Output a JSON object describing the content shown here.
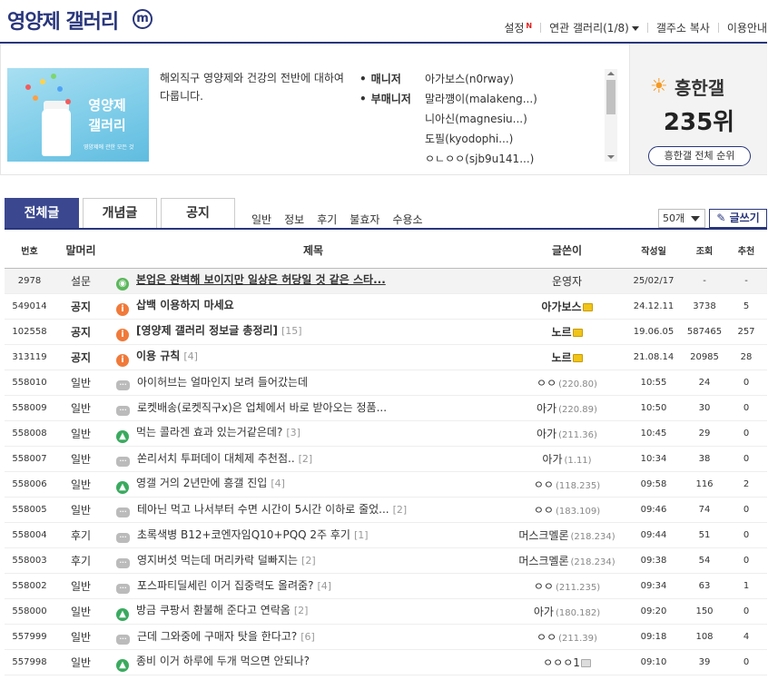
{
  "header": {
    "title": "영양제 갤러리",
    "badge": "m",
    "menu": [
      {
        "label": "설정",
        "new": "N"
      },
      {
        "label": "연관 갤러리(1/8)",
        "caret": true
      },
      {
        "label": "갤주소 복사"
      },
      {
        "label": "이용안내"
      }
    ]
  },
  "info": {
    "thumbnail_text": "영양제\n갤러리",
    "thumbnail_small": "영양제에 관한 모든 것",
    "description": "해외직구 영양제와 건강의 전반에 대하여 다룹니다.",
    "manager_label": "매니저",
    "manager": "아가보스(n0rway)",
    "sub_manager_label": "부매니저",
    "sub_managers": [
      "말라꺵이(malakeng...)",
      "니아신(magnesiu...)",
      "도필(kyodophi...)",
      "ㅇㄴㅇㅇ(sjb9u141...)"
    ],
    "rank_label": "흥한갤",
    "rank_value": "235위",
    "rank_button": "흥한갤 전체 순위"
  },
  "tabs": {
    "main": [
      {
        "label": "전체글",
        "active": true
      },
      {
        "label": "개념글",
        "active": false
      },
      {
        "label": "공지",
        "active": false
      }
    ],
    "sub": [
      "일반",
      "정보",
      "후기",
      "불효자",
      "수용소"
    ],
    "page_size": "50개",
    "write_button": "글쓰기"
  },
  "table": {
    "headers": [
      "번호",
      "말머리",
      "제목",
      "글쓴이",
      "작성일",
      "조회",
      "추천"
    ],
    "rows": [
      {
        "no": "2978",
        "head": "설문",
        "icon": "survey",
        "subject": "본업은 완벽해 보이지만 일상은 허당일 것 같은 스타...",
        "replies": "",
        "writer": "운영자",
        "ip": "",
        "badge": "",
        "date": "25/02/17",
        "views": "-",
        "recs": "-",
        "type": "pinned"
      },
      {
        "no": "549014",
        "head": "공지",
        "icon": "notice",
        "subject": "삽백 이용하지 마세요",
        "replies": "",
        "writer": "아가보스",
        "ip": "",
        "badge": "gold",
        "date": "24.12.11",
        "views": "3738",
        "recs": "5",
        "type": "notice"
      },
      {
        "no": "102558",
        "head": "공지",
        "icon": "notice",
        "subject": "[영양제 갤러리 정보글 총정리]",
        "replies": "[15]",
        "writer": "노르",
        "ip": "",
        "badge": "gold",
        "date": "19.06.05",
        "views": "587465",
        "recs": "257",
        "type": "notice"
      },
      {
        "no": "313119",
        "head": "공지",
        "icon": "notice",
        "subject": "이용 규칙",
        "replies": "[4]",
        "writer": "노르",
        "ip": "",
        "badge": "gold",
        "date": "21.08.14",
        "views": "20985",
        "recs": "28",
        "type": "notice"
      },
      {
        "no": "558010",
        "head": "일반",
        "icon": "text",
        "subject": "아이허브는 얼마인지 보려 들어갔는데",
        "replies": "",
        "writer": "ㅇㅇ",
        "ip": "(220.80)",
        "badge": "",
        "date": "10:55",
        "views": "24",
        "recs": "0",
        "type": "normal"
      },
      {
        "no": "558009",
        "head": "일반",
        "icon": "text",
        "subject": "로켓배송(로켓직구x)은 업체에서 바로 받아오는 정품...",
        "replies": "",
        "writer": "아가",
        "ip": "(220.89)",
        "badge": "",
        "date": "10:50",
        "views": "30",
        "recs": "0",
        "type": "normal"
      },
      {
        "no": "558008",
        "head": "일반",
        "icon": "image",
        "subject": "먹는 콜라겐 효과 있는거같은데?",
        "replies": "[3]",
        "writer": "아가",
        "ip": "(211.36)",
        "badge": "",
        "date": "10:45",
        "views": "29",
        "recs": "0",
        "type": "normal"
      },
      {
        "no": "558007",
        "head": "일반",
        "icon": "text",
        "subject": "쏜리서치 투퍼데이 대체제 추천점..",
        "replies": "[2]",
        "writer": "아가",
        "ip": "(1.11)",
        "badge": "",
        "date": "10:34",
        "views": "38",
        "recs": "0",
        "type": "normal"
      },
      {
        "no": "558006",
        "head": "일반",
        "icon": "image",
        "subject": "영갤 거의 2년만에 흥갤 진입",
        "replies": "[4]",
        "writer": "ㅇㅇ",
        "ip": "(118.235)",
        "badge": "",
        "date": "09:58",
        "views": "116",
        "recs": "2",
        "type": "normal"
      },
      {
        "no": "558005",
        "head": "일반",
        "icon": "text",
        "subject": "테아닌 먹고 나서부터 수면 시간이 5시간 이하로 줄었...",
        "replies": "[2]",
        "writer": "ㅇㅇ",
        "ip": "(183.109)",
        "badge": "",
        "date": "09:46",
        "views": "74",
        "recs": "0",
        "type": "normal"
      },
      {
        "no": "558004",
        "head": "후기",
        "icon": "text",
        "subject": "초록색병 B12+코엔자임Q10+PQQ 2주 후기",
        "replies": "[1]",
        "writer": "머스크멜론",
        "ip": "(218.234)",
        "badge": "",
        "date": "09:44",
        "views": "51",
        "recs": "0",
        "type": "normal"
      },
      {
        "no": "558003",
        "head": "후기",
        "icon": "text",
        "subject": "영지버섯 먹는데 머리카락 덜빠지는",
        "replies": "[2]",
        "writer": "머스크멜론",
        "ip": "(218.234)",
        "badge": "",
        "date": "09:38",
        "views": "54",
        "recs": "0",
        "type": "normal"
      },
      {
        "no": "558002",
        "head": "일반",
        "icon": "text",
        "subject": "포스파티딜세린 이거 집중력도 올려줌?",
        "replies": "[4]",
        "writer": "ㅇㅇ",
        "ip": "(211.235)",
        "badge": "",
        "date": "09:34",
        "views": "63",
        "recs": "1",
        "type": "normal"
      },
      {
        "no": "558000",
        "head": "일반",
        "icon": "image",
        "subject": "방금 쿠팡서 환불해 준다고 연락옴",
        "replies": "[2]",
        "writer": "아가",
        "ip": "(180.182)",
        "badge": "",
        "date": "09:20",
        "views": "150",
        "recs": "0",
        "type": "normal"
      },
      {
        "no": "557999",
        "head": "일반",
        "icon": "text",
        "subject": "근데 그와중에 구매자 탓을 한다고?",
        "replies": "[6]",
        "writer": "ㅇㅇ",
        "ip": "(211.39)",
        "badge": "",
        "date": "09:18",
        "views": "108",
        "recs": "4",
        "type": "normal"
      },
      {
        "no": "557998",
        "head": "일반",
        "icon": "image",
        "subject": "종비 이거 하루에 두개 먹으면 안되나?",
        "replies": "",
        "writer": "ㅇㅇㅇ1",
        "ip": "",
        "badge": "grey",
        "date": "09:10",
        "views": "39",
        "recs": "0",
        "type": "normal"
      }
    ]
  }
}
